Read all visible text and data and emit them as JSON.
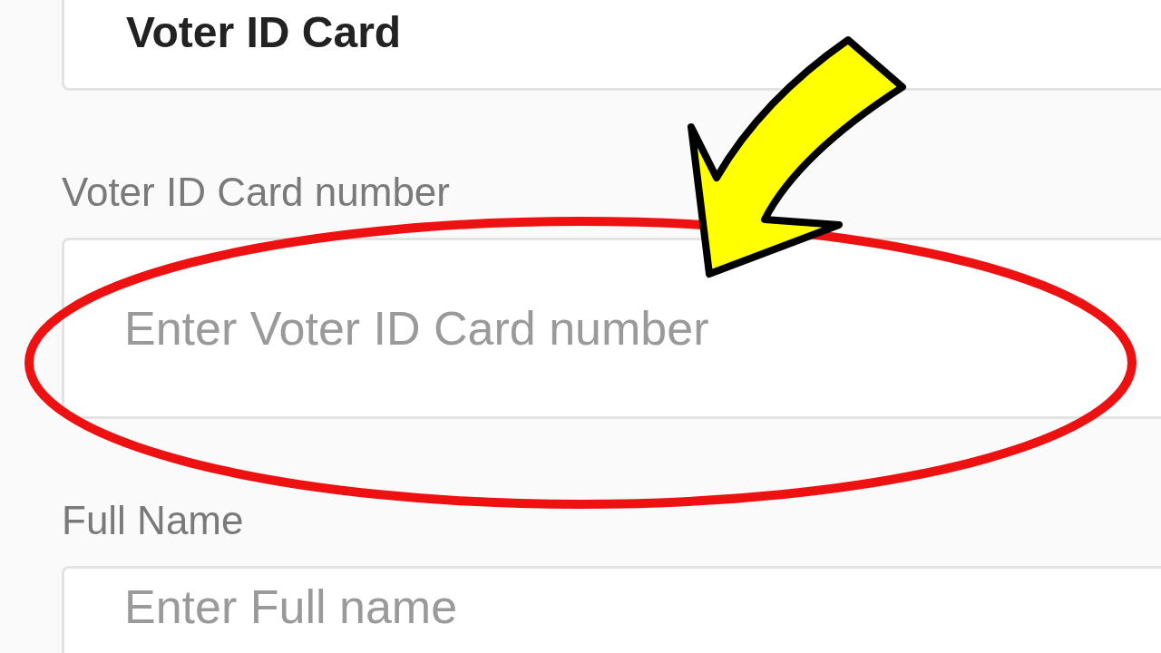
{
  "top_field": {
    "value": "Voter ID Card"
  },
  "fields": [
    {
      "label": "Voter ID Card number",
      "placeholder": "Enter Voter ID Card number"
    },
    {
      "label": "Full Name",
      "placeholder": "Enter Full name"
    }
  ]
}
